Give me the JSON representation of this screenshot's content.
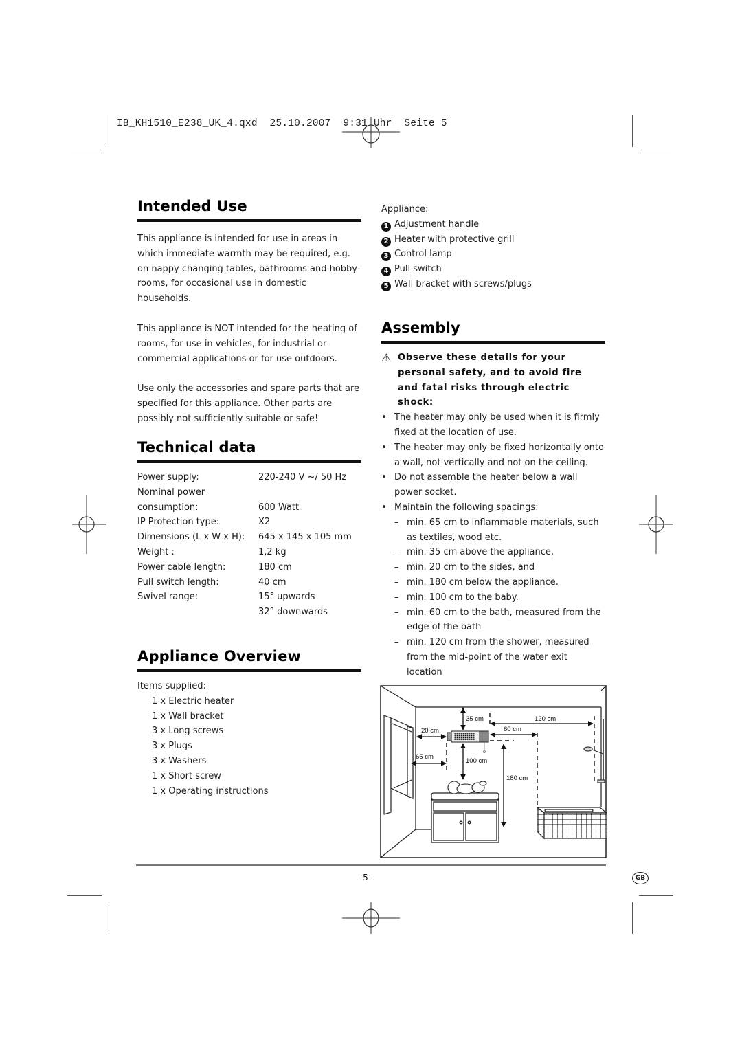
{
  "slug": "IB_KH1510_E238_UK_4.qxd  25.10.2007  9:31 Uhr  Seite 5",
  "intended_use": {
    "title": "Intended Use",
    "paragraphs": [
      "This appliance is intended for use in areas in which immediate warmth may be required, e.g. on nappy changing tables, bathrooms and hobby-rooms, for occasional use in domestic households.",
      "This appliance is NOT intended for the heating of rooms, for use in vehicles, for industrial or commercial applications or for use outdoors.",
      "Use only the accessories and spare parts that are specified for this appliance. Other parts are possibly not sufficiently suitable or safe!"
    ]
  },
  "technical_data": {
    "title": "Technical data",
    "rows": [
      {
        "label": "Power supply:",
        "value": "220-240 V ~/ 50 Hz"
      },
      {
        "label": "Nominal power",
        "value": ""
      },
      {
        "label": "consumption:",
        "value": "600 Watt"
      },
      {
        "label": "IP Protection type:",
        "value": "X2"
      },
      {
        "label": "Dimensions (L x W x H):",
        "value": "645 x 145 x 105 mm"
      },
      {
        "label": "Weight :",
        "value": "1,2 kg"
      },
      {
        "label": "Power cable length:",
        "value": "180 cm"
      },
      {
        "label": "Pull switch length:",
        "value": "40 cm"
      },
      {
        "label": "Swivel range:",
        "value": "15° upwards"
      },
      {
        "label": "",
        "value": "32° downwards"
      }
    ]
  },
  "appliance_overview": {
    "title": "Appliance Overview",
    "items_label": "Items supplied:",
    "items": [
      "1 x Electric heater",
      "1 x Wall bracket",
      "3 x Long screws",
      "3 x Plugs",
      "3 x Washers",
      "1 x Short screw",
      "1 x Operating instructions"
    ]
  },
  "appliance_parts": {
    "label": "Appliance:",
    "parts": [
      {
        "num": "1",
        "text": "Adjustment handle"
      },
      {
        "num": "2",
        "text": "Heater with protective grill"
      },
      {
        "num": "3",
        "text": "Control lamp"
      },
      {
        "num": "4",
        "text": "Pull switch"
      },
      {
        "num": "5",
        "text": "Wall bracket with screws/plugs"
      }
    ]
  },
  "assembly": {
    "title": "Assembly",
    "warning_icon": "warning-triangle-icon",
    "warning": "Observe these details for your personal safety, and to avoid fire and fatal risks through electric shock:",
    "bullets": [
      "The heater may only be used when it is firmly fixed at the location of use.",
      "The heater may only be fixed horizontally onto a wall, not vertically and not on the ceiling.",
      "Do not assemble the heater below a wall power socket.",
      "Maintain the following spacings:"
    ],
    "spacings": [
      "min. 65 cm to inflammable materials, such as textiles, wood etc.",
      "min. 35 cm above the appliance,",
      "min. 20 cm to the sides, and",
      "min. 180 cm below the appliance.",
      "min. 100 cm to the baby.",
      "min. 60 cm to the bath, measured from the edge of the bath",
      "min. 120 cm from the shower, measured from the mid-point of the water exit location"
    ]
  },
  "diagram": {
    "labels": {
      "above": "35 cm",
      "sides": "20 cm",
      "inflammable": "65 cm",
      "baby": "100 cm",
      "below": "180 cm",
      "bath": "60 cm",
      "shower": "120 cm"
    }
  },
  "footer": {
    "page": "- 5 -",
    "lang_badge": "GB"
  }
}
